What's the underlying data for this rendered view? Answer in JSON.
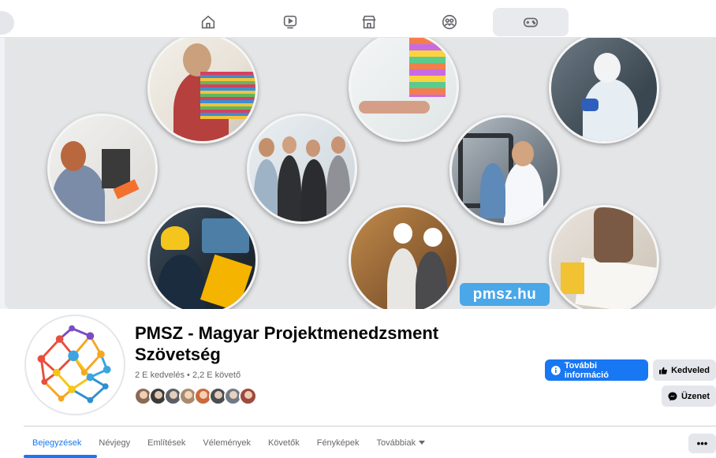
{
  "nav": {
    "items": [
      {
        "icon": "home-icon"
      },
      {
        "icon": "video-icon"
      },
      {
        "icon": "marketplace-icon"
      },
      {
        "icon": "groups-icon"
      },
      {
        "icon": "gaming-icon",
        "active": true
      }
    ]
  },
  "cover": {
    "badge_text": "pmsz.hu"
  },
  "profile": {
    "name": "PMSZ - Magyar Projektmenedzsment Szövetség",
    "stats": "2 E kedvelés • 2,2 E követő"
  },
  "actions": {
    "info_label": "További információ",
    "like_label": "Kedveled",
    "message_label": "Üzenet"
  },
  "tabs": {
    "items": [
      {
        "label": "Bejegyzések"
      },
      {
        "label": "Névjegy"
      },
      {
        "label": "Említések"
      },
      {
        "label": "Vélemények"
      },
      {
        "label": "Követők"
      },
      {
        "label": "Fényképek"
      },
      {
        "label": "Továbbiak"
      }
    ],
    "more_label": "•••"
  },
  "colors": {
    "accent": "#1877f2",
    "badge": "#4aa7e8"
  }
}
